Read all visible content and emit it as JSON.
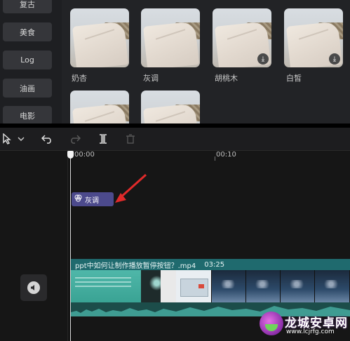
{
  "categories": [
    "复古",
    "美食",
    "Log",
    "油画",
    "电影"
  ],
  "filters": [
    {
      "label": "奶杏",
      "download": false
    },
    {
      "label": "灰调",
      "download": false
    },
    {
      "label": "胡桃木",
      "download": true
    },
    {
      "label": "白皙",
      "download": true
    },
    {
      "label": "",
      "download": false
    },
    {
      "label": "",
      "download": false
    }
  ],
  "timeline": {
    "ticks": [
      "00:00",
      "00:10"
    ],
    "filter_clip_label": "灰调",
    "video": {
      "filename": "ppt中如何让制作播放暂停按钮？.mp4",
      "duration": "03:25"
    }
  },
  "watermark": {
    "name": "龙城安卓网",
    "url": "www.lcjrfg.com"
  },
  "colors": {
    "filter_clip": "#4c4a8c",
    "video_track": "#1f6a6e",
    "arrow": "#e02a2a"
  }
}
